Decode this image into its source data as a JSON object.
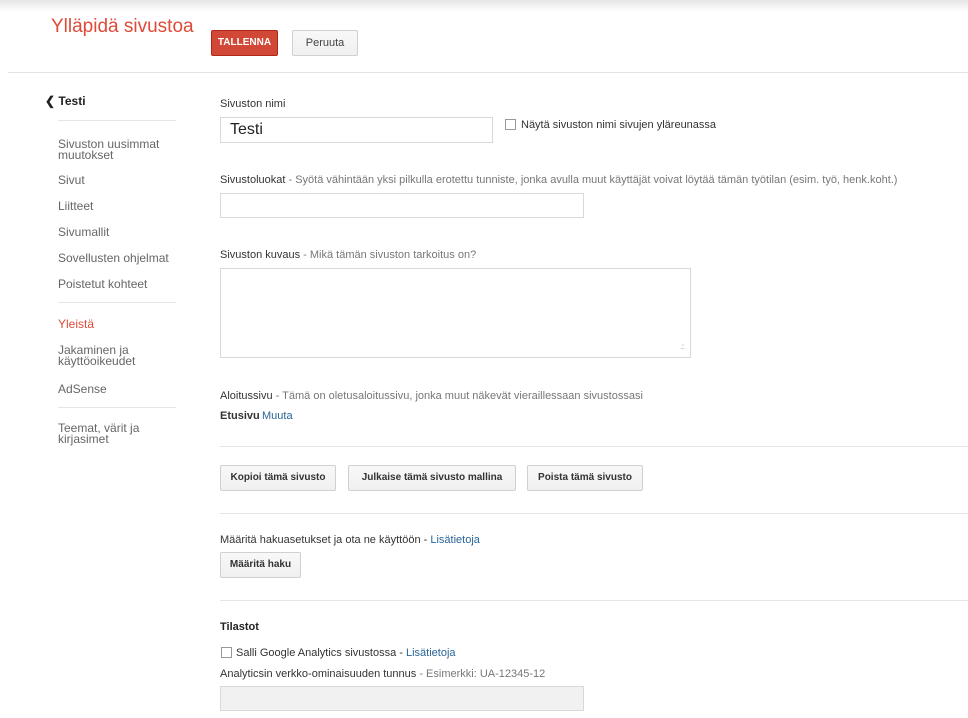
{
  "header": {
    "title": "Ylläpidä sivustoa",
    "save_label": "TALLENNA",
    "cancel_label": "Peruuta"
  },
  "sidebar": {
    "back_label": "Testi",
    "group1": [
      "Sivuston uusimmat muutokset",
      "Sivut",
      "Liitteet",
      "Sivumallit",
      "Sovellusten ohjelmat",
      "Poistetut kohteet"
    ],
    "group2": [
      "Yleistä",
      "Jakaminen ja käyttöoikeudet",
      "AdSense"
    ],
    "group3": [
      "Teemat, värit ja kirjasimet"
    ],
    "active_item": "Yleistä"
  },
  "site_name": {
    "label": "Sivuston nimi",
    "value": "Testi",
    "show_in_header_label": "Näytä sivuston nimi sivujen yläreunassa",
    "show_in_header_checked": false
  },
  "categories": {
    "label": "Sivustoluokat",
    "hint": " - Syötä vähintään yksi pilkulla erotettu tunniste, jonka avulla muut käyttäjät voivat löytää tämän työtilan (esim. työ, henk.koht.)",
    "value": ""
  },
  "description": {
    "label": "Sivuston kuvaus",
    "hint": " - Mikä tämän sivuston tarkoitus on?",
    "value": ""
  },
  "landing_page": {
    "label": "Aloitussivu",
    "hint": " - Tämä on oletusaloitussivu, jonka muut näkevät vieraillessaan sivustossasi",
    "page": "Etusivu",
    "change_link": "Muuta"
  },
  "actions": {
    "copy": "Kopioi tämä sivusto",
    "publish_template": "Julkaise tämä sivusto mallina",
    "delete": "Poista tämä sivusto"
  },
  "search": {
    "text": "Määritä hakuasetukset ja ota ne käyttöön - ",
    "link": "Lisätietoja",
    "button": "Määritä haku"
  },
  "stats": {
    "heading": "Tilastot",
    "analytics_label": "Salli Google Analytics sivustossa - ",
    "analytics_link": "Lisätietoja",
    "analytics_checked": false,
    "property_label": "Analyticsin verkko-ominaisuuden tunnus",
    "property_hint": " - Esimerkki: UA-12345-12",
    "property_value": ""
  },
  "colors": {
    "accent": "#dd4b39",
    "save_button": "#d14836",
    "link": "#2a6496"
  }
}
